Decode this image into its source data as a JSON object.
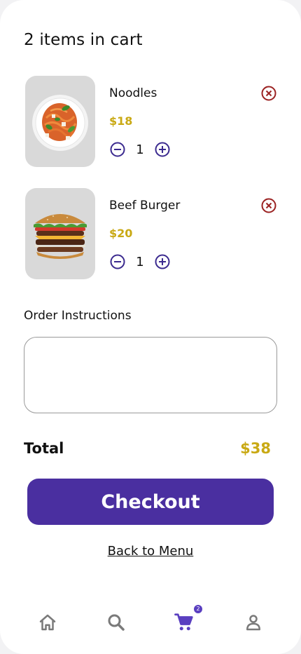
{
  "cart": {
    "title": "2 items in cart",
    "items": [
      {
        "name": "Noodles",
        "price": "$18",
        "quantity": "1",
        "image_icon": "noodles-plate-image"
      },
      {
        "name": "Beef Burger",
        "price": "$20",
        "quantity": "1",
        "image_icon": "beef-burger-image"
      }
    ]
  },
  "instructions": {
    "label": "Order Instructions",
    "value": "",
    "placeholder": ""
  },
  "summary": {
    "total_label": "Total",
    "total_value": "$38"
  },
  "actions": {
    "checkout_label": "Checkout",
    "back_label": "Back to Menu"
  },
  "bottom_nav": {
    "items": [
      {
        "icon": "home-icon",
        "active": false
      },
      {
        "icon": "search-icon",
        "active": false
      },
      {
        "icon": "cart-icon",
        "active": true
      },
      {
        "icon": "profile-icon",
        "active": false
      }
    ],
    "cart_badge": "2"
  },
  "colors": {
    "accent": "#4a2fa0",
    "price": "#c9a914",
    "remove": "#9b2222",
    "nav_inactive": "#7a7a7a",
    "thumb_bg": "#d9d9d9"
  }
}
